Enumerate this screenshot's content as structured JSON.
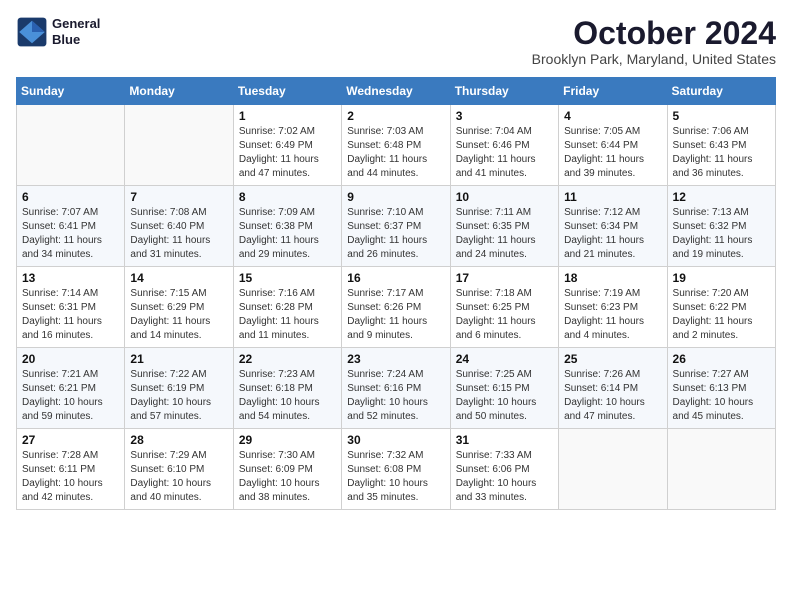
{
  "header": {
    "logo_line1": "General",
    "logo_line2": "Blue",
    "month": "October 2024",
    "location": "Brooklyn Park, Maryland, United States"
  },
  "weekdays": [
    "Sunday",
    "Monday",
    "Tuesday",
    "Wednesday",
    "Thursday",
    "Friday",
    "Saturday"
  ],
  "weeks": [
    [
      {
        "day": "",
        "sunrise": "",
        "sunset": "",
        "daylight": ""
      },
      {
        "day": "",
        "sunrise": "",
        "sunset": "",
        "daylight": ""
      },
      {
        "day": "1",
        "sunrise": "Sunrise: 7:02 AM",
        "sunset": "Sunset: 6:49 PM",
        "daylight": "Daylight: 11 hours and 47 minutes."
      },
      {
        "day": "2",
        "sunrise": "Sunrise: 7:03 AM",
        "sunset": "Sunset: 6:48 PM",
        "daylight": "Daylight: 11 hours and 44 minutes."
      },
      {
        "day": "3",
        "sunrise": "Sunrise: 7:04 AM",
        "sunset": "Sunset: 6:46 PM",
        "daylight": "Daylight: 11 hours and 41 minutes."
      },
      {
        "day": "4",
        "sunrise": "Sunrise: 7:05 AM",
        "sunset": "Sunset: 6:44 PM",
        "daylight": "Daylight: 11 hours and 39 minutes."
      },
      {
        "day": "5",
        "sunrise": "Sunrise: 7:06 AM",
        "sunset": "Sunset: 6:43 PM",
        "daylight": "Daylight: 11 hours and 36 minutes."
      }
    ],
    [
      {
        "day": "6",
        "sunrise": "Sunrise: 7:07 AM",
        "sunset": "Sunset: 6:41 PM",
        "daylight": "Daylight: 11 hours and 34 minutes."
      },
      {
        "day": "7",
        "sunrise": "Sunrise: 7:08 AM",
        "sunset": "Sunset: 6:40 PM",
        "daylight": "Daylight: 11 hours and 31 minutes."
      },
      {
        "day": "8",
        "sunrise": "Sunrise: 7:09 AM",
        "sunset": "Sunset: 6:38 PM",
        "daylight": "Daylight: 11 hours and 29 minutes."
      },
      {
        "day": "9",
        "sunrise": "Sunrise: 7:10 AM",
        "sunset": "Sunset: 6:37 PM",
        "daylight": "Daylight: 11 hours and 26 minutes."
      },
      {
        "day": "10",
        "sunrise": "Sunrise: 7:11 AM",
        "sunset": "Sunset: 6:35 PM",
        "daylight": "Daylight: 11 hours and 24 minutes."
      },
      {
        "day": "11",
        "sunrise": "Sunrise: 7:12 AM",
        "sunset": "Sunset: 6:34 PM",
        "daylight": "Daylight: 11 hours and 21 minutes."
      },
      {
        "day": "12",
        "sunrise": "Sunrise: 7:13 AM",
        "sunset": "Sunset: 6:32 PM",
        "daylight": "Daylight: 11 hours and 19 minutes."
      }
    ],
    [
      {
        "day": "13",
        "sunrise": "Sunrise: 7:14 AM",
        "sunset": "Sunset: 6:31 PM",
        "daylight": "Daylight: 11 hours and 16 minutes."
      },
      {
        "day": "14",
        "sunrise": "Sunrise: 7:15 AM",
        "sunset": "Sunset: 6:29 PM",
        "daylight": "Daylight: 11 hours and 14 minutes."
      },
      {
        "day": "15",
        "sunrise": "Sunrise: 7:16 AM",
        "sunset": "Sunset: 6:28 PM",
        "daylight": "Daylight: 11 hours and 11 minutes."
      },
      {
        "day": "16",
        "sunrise": "Sunrise: 7:17 AM",
        "sunset": "Sunset: 6:26 PM",
        "daylight": "Daylight: 11 hours and 9 minutes."
      },
      {
        "day": "17",
        "sunrise": "Sunrise: 7:18 AM",
        "sunset": "Sunset: 6:25 PM",
        "daylight": "Daylight: 11 hours and 6 minutes."
      },
      {
        "day": "18",
        "sunrise": "Sunrise: 7:19 AM",
        "sunset": "Sunset: 6:23 PM",
        "daylight": "Daylight: 11 hours and 4 minutes."
      },
      {
        "day": "19",
        "sunrise": "Sunrise: 7:20 AM",
        "sunset": "Sunset: 6:22 PM",
        "daylight": "Daylight: 11 hours and 2 minutes."
      }
    ],
    [
      {
        "day": "20",
        "sunrise": "Sunrise: 7:21 AM",
        "sunset": "Sunset: 6:21 PM",
        "daylight": "Daylight: 10 hours and 59 minutes."
      },
      {
        "day": "21",
        "sunrise": "Sunrise: 7:22 AM",
        "sunset": "Sunset: 6:19 PM",
        "daylight": "Daylight: 10 hours and 57 minutes."
      },
      {
        "day": "22",
        "sunrise": "Sunrise: 7:23 AM",
        "sunset": "Sunset: 6:18 PM",
        "daylight": "Daylight: 10 hours and 54 minutes."
      },
      {
        "day": "23",
        "sunrise": "Sunrise: 7:24 AM",
        "sunset": "Sunset: 6:16 PM",
        "daylight": "Daylight: 10 hours and 52 minutes."
      },
      {
        "day": "24",
        "sunrise": "Sunrise: 7:25 AM",
        "sunset": "Sunset: 6:15 PM",
        "daylight": "Daylight: 10 hours and 50 minutes."
      },
      {
        "day": "25",
        "sunrise": "Sunrise: 7:26 AM",
        "sunset": "Sunset: 6:14 PM",
        "daylight": "Daylight: 10 hours and 47 minutes."
      },
      {
        "day": "26",
        "sunrise": "Sunrise: 7:27 AM",
        "sunset": "Sunset: 6:13 PM",
        "daylight": "Daylight: 10 hours and 45 minutes."
      }
    ],
    [
      {
        "day": "27",
        "sunrise": "Sunrise: 7:28 AM",
        "sunset": "Sunset: 6:11 PM",
        "daylight": "Daylight: 10 hours and 42 minutes."
      },
      {
        "day": "28",
        "sunrise": "Sunrise: 7:29 AM",
        "sunset": "Sunset: 6:10 PM",
        "daylight": "Daylight: 10 hours and 40 minutes."
      },
      {
        "day": "29",
        "sunrise": "Sunrise: 7:30 AM",
        "sunset": "Sunset: 6:09 PM",
        "daylight": "Daylight: 10 hours and 38 minutes."
      },
      {
        "day": "30",
        "sunrise": "Sunrise: 7:32 AM",
        "sunset": "Sunset: 6:08 PM",
        "daylight": "Daylight: 10 hours and 35 minutes."
      },
      {
        "day": "31",
        "sunrise": "Sunrise: 7:33 AM",
        "sunset": "Sunset: 6:06 PM",
        "daylight": "Daylight: 10 hours and 33 minutes."
      },
      {
        "day": "",
        "sunrise": "",
        "sunset": "",
        "daylight": ""
      },
      {
        "day": "",
        "sunrise": "",
        "sunset": "",
        "daylight": ""
      }
    ]
  ]
}
